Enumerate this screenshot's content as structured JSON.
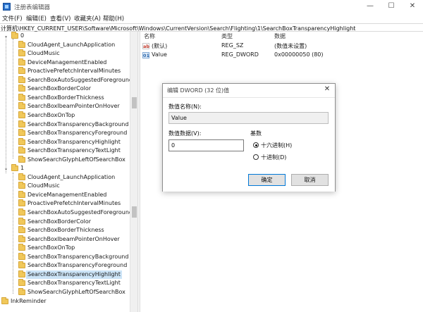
{
  "window": {
    "title": "注册表编辑器",
    "min_glyph": "—",
    "max_glyph": "☐",
    "close_glyph": "✕"
  },
  "menu": [
    "文件(F)",
    "编辑(E)",
    "查看(V)",
    "收藏夹(A)",
    "帮助(H)"
  ],
  "address": "计算机\\HKEY_CURRENT_USER\\Software\\Microsoft\\Windows\\CurrentVersion\\Search\\Flighting\\1\\SearchBoxTransparencyHighlight",
  "tree": {
    "node0": "0",
    "node1": "1",
    "group0": [
      "CloudAgent_LaunchApplication",
      "CloudMusic",
      "DeviceManagementEnabled",
      "ProactivePrefetchIntervalMinutes",
      "SearchBoxAutoSuggestedForegroundCo",
      "SearchBoxBorderColor",
      "SearchBoxBorderThickness",
      "SearchBoxIbeamPointerOnHover",
      "SearchBoxOnTop",
      "SearchBoxTransparencyBackground",
      "SearchBoxTransparencyForeground",
      "SearchBoxTransparencyHighlight",
      "SearchBoxTransparencyTextLight",
      "ShowSearchGlyphLeftOfSearchBox"
    ],
    "group1": [
      "CloudAgent_LaunchApplication",
      "CloudMusic",
      "DeviceManagementEnabled",
      "ProactivePrefetchIntervalMinutes",
      "SearchBoxAutoSuggestedForegroundColor",
      "SearchBoxBorderColor",
      "SearchBoxBorderThickness",
      "SearchBoxIbeamPointerOnHover",
      "SearchBoxOnTop",
      "SearchBoxTransparencyBackground",
      "SearchBoxTransparencyForeground",
      "SearchBoxTransparencyHighlight",
      "SearchBoxTransparencyTextLight",
      "ShowSearchGlyphLeftOfSearchBox"
    ],
    "after": "InkReminder",
    "selected_group": 1,
    "selected_index": 11,
    "expander_glyph": "⌄"
  },
  "values": {
    "headers": {
      "name": "名称",
      "type": "类型",
      "data": "数据"
    },
    "rows": [
      {
        "icon": "string-value-icon",
        "icon_text": "ab",
        "name": "(默认)",
        "type": "REG_SZ",
        "data": "(数值未设置)"
      },
      {
        "icon": "dword-value-icon",
        "icon_text": "01",
        "name": "Value",
        "type": "REG_DWORD",
        "data": "0x00000050 (80)"
      }
    ]
  },
  "dialog": {
    "title": "编辑 DWORD (32 位)值",
    "close_glyph": "✕",
    "name_label": "数值名称(N):",
    "name_value": "Value",
    "data_label": "数值数据(V):",
    "data_value": "0",
    "base_label": "基数",
    "hex_label": "十六进制(H)",
    "dec_label": "十进制(D)",
    "selected_base": "hex",
    "ok_label": "确定",
    "cancel_label": "取消"
  },
  "colors": {
    "selection": "#cce4f7",
    "folder": "#f1c85a",
    "default_button_border": "#0078d7"
  }
}
